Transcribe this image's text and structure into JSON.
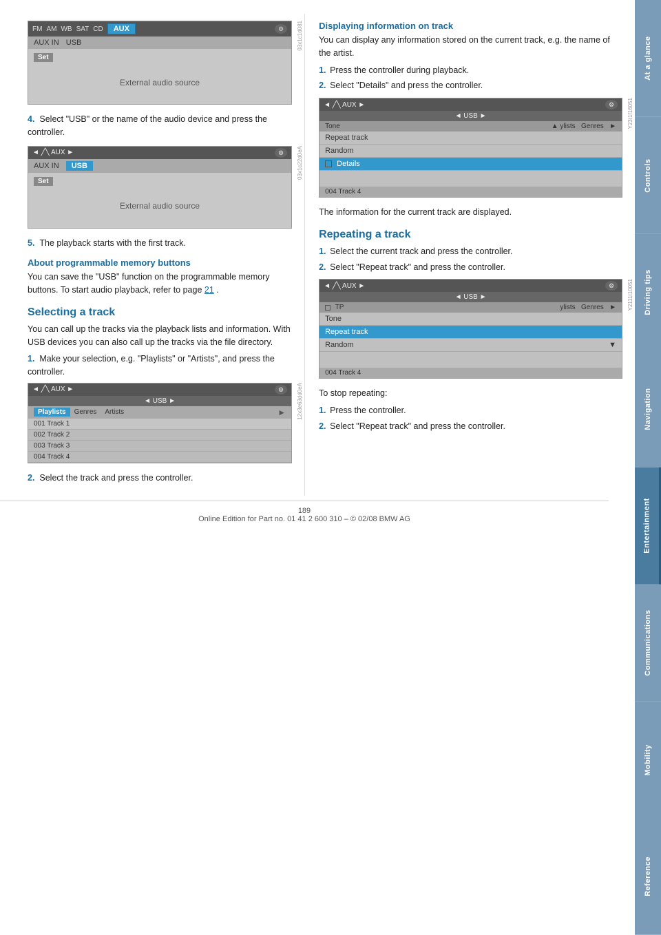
{
  "sidebar": {
    "tabs": [
      {
        "label": "At a glance",
        "class": "tab-at-glance"
      },
      {
        "label": "Controls",
        "class": "tab-controls"
      },
      {
        "label": "Driving tips",
        "class": "tab-driving"
      },
      {
        "label": "Navigation",
        "class": "tab-navigation"
      },
      {
        "label": "Entertainment",
        "class": "tab-entertainment"
      },
      {
        "label": "Communications",
        "class": "tab-communications"
      },
      {
        "label": "Mobility",
        "class": "tab-mobility"
      },
      {
        "label": "Reference",
        "class": "tab-reference"
      }
    ]
  },
  "left_column": {
    "step4_text": "Select \"USB\" or the name of the audio device and press the controller.",
    "step5_text": "The playback starts with the first track.",
    "about_title": "About programmable memory buttons",
    "about_text": "You can save the \"USB\" function on the programmable memory buttons. To start audio playback, refer to page",
    "about_link": "21",
    "about_period": ".",
    "selecting_title": "Selecting a track",
    "selecting_text": "You can call up the tracks via the playback lists and information. With USB devices you can also call up the tracks via the file directory.",
    "step1_text": "Make your selection, e.g. \"Playlists\" or \"Artists\", and press the controller.",
    "step2_text": "Select the track and press the controller.",
    "screens": {
      "screen1": {
        "topbar_items": [
          "FM",
          "AM",
          "WB",
          "SAT",
          "CD",
          "AUX"
        ],
        "active": "AUX",
        "row2": [
          "AUX IN",
          "USB"
        ],
        "set_label": "Set",
        "body_text": "External audio source"
      },
      "screen2": {
        "nav_left": "◄ ╱╲ AUX ►",
        "nav_right": "",
        "row2": [
          "AUX IN",
          "USB"
        ],
        "usb_active": true,
        "set_label": "Set",
        "body_text": "External audio source"
      },
      "screen3": {
        "nav": "◄ ╱╲ AUX ►",
        "sub_nav": "◄ USB ►",
        "tabs": [
          "Playlists",
          "Genres",
          "Artists"
        ],
        "active_tab": "Playlists",
        "tracks": [
          "001 Track 1",
          "002 Track 2",
          "003 Track 3",
          "004 Track 4"
        ]
      }
    }
  },
  "right_column": {
    "displaying_title": "Displaying information on track",
    "displaying_text": "You can display any information stored on the current track, e.g. the name of the artist.",
    "disp_step1": "Press the controller during playback.",
    "disp_step2": "Select \"Details\" and press the controller.",
    "disp_info_text": "The information for the current track are displayed.",
    "repeating_title": "Repeating a track",
    "rep_step1": "Select the current track and press the controller.",
    "rep_step2": "Select \"Repeat track\" and press the controller.",
    "stop_repeat_text": "To stop repeating:",
    "stop_step1": "Press the controller.",
    "stop_step2": "Select \"Repeat track\" and press the controller.",
    "screens": {
      "screen_details": {
        "nav": "◄ ╱╲ AUX ►",
        "sub_nav": "◄ USB ►",
        "menu_items": [
          "Tone",
          "Repeat track",
          "Random",
          "Details"
        ],
        "active_item": "Details",
        "footer": "004 Track 4",
        "tabs_right": "ylists   Genres"
      },
      "screen_repeat": {
        "nav": "◄ ╱╲ AUX ►",
        "sub_nav": "◄ USB ►",
        "menu_items": [
          "TP",
          "Tone",
          "Repeat track",
          "Random"
        ],
        "active_item": "Repeat track",
        "footer": "004 Track 4",
        "tabs_right": "ylists   Genres"
      }
    }
  },
  "footer": {
    "page_number": "189",
    "copyright": "Online Edition for Part no. 01 41 2 600 310 – © 02/08 BMW AG"
  }
}
